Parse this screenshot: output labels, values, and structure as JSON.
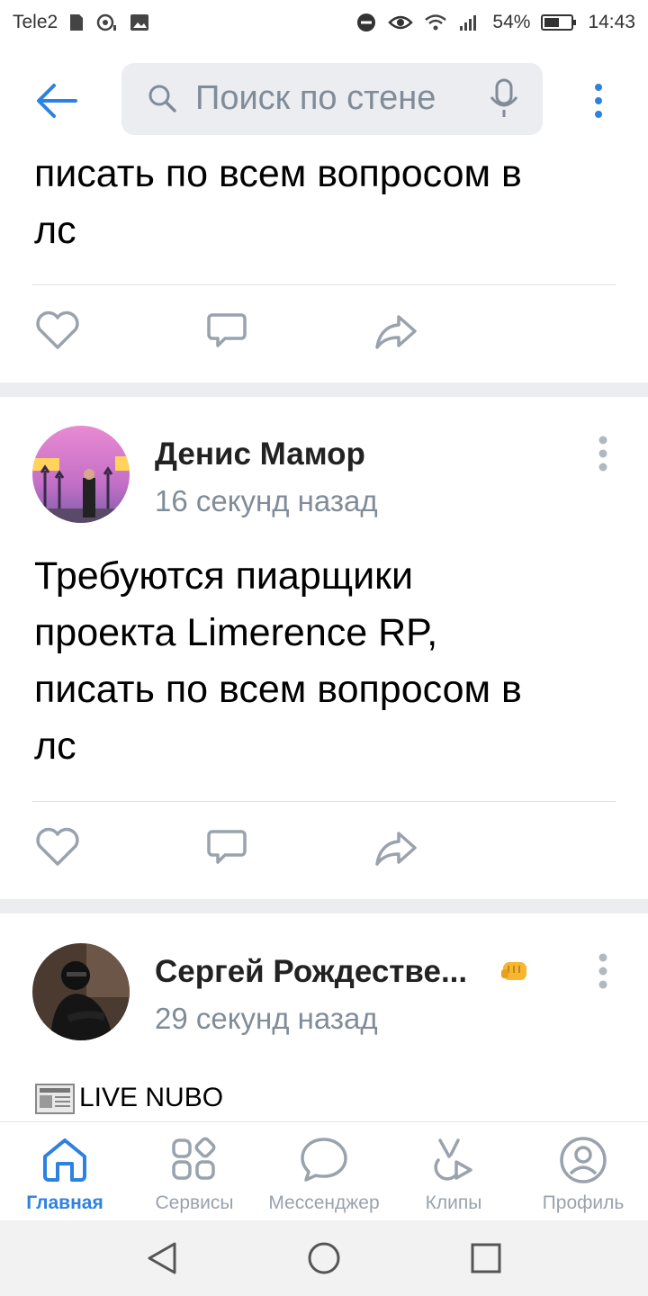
{
  "status_bar": {
    "carrier": "Tele2",
    "battery": "54%",
    "time": "14:43"
  },
  "header": {
    "search_placeholder": "Поиск по стене"
  },
  "partial_post": {
    "text_line1": "писать по всем вопросом в",
    "text_line2": "лс"
  },
  "post1": {
    "author": "Денис Мамор",
    "time": "16 секунд назад",
    "text_line1": "Требуются пиарщики",
    "text_line2": "проекта Limerence RP,",
    "text_line3": "писать по всем вопросом в",
    "text_line4": "лс"
  },
  "post2": {
    "author": "Сергей Рождестве...",
    "time": "29 секунд назад",
    "text": "LIVE NUBO"
  },
  "tabbar": {
    "items": [
      {
        "label": "Главная",
        "icon": "home-icon",
        "active": true
      },
      {
        "label": "Сервисы",
        "icon": "services-icon",
        "active": false
      },
      {
        "label": "Мессенджер",
        "icon": "messenger-icon",
        "active": false
      },
      {
        "label": "Клипы",
        "icon": "clips-icon",
        "active": false
      },
      {
        "label": "Профиль",
        "icon": "profile-icon",
        "active": false
      }
    ]
  },
  "colors": {
    "accent": "#2d81e0",
    "secondary_text": "#818c99",
    "icon_gray": "#99a2ad"
  }
}
